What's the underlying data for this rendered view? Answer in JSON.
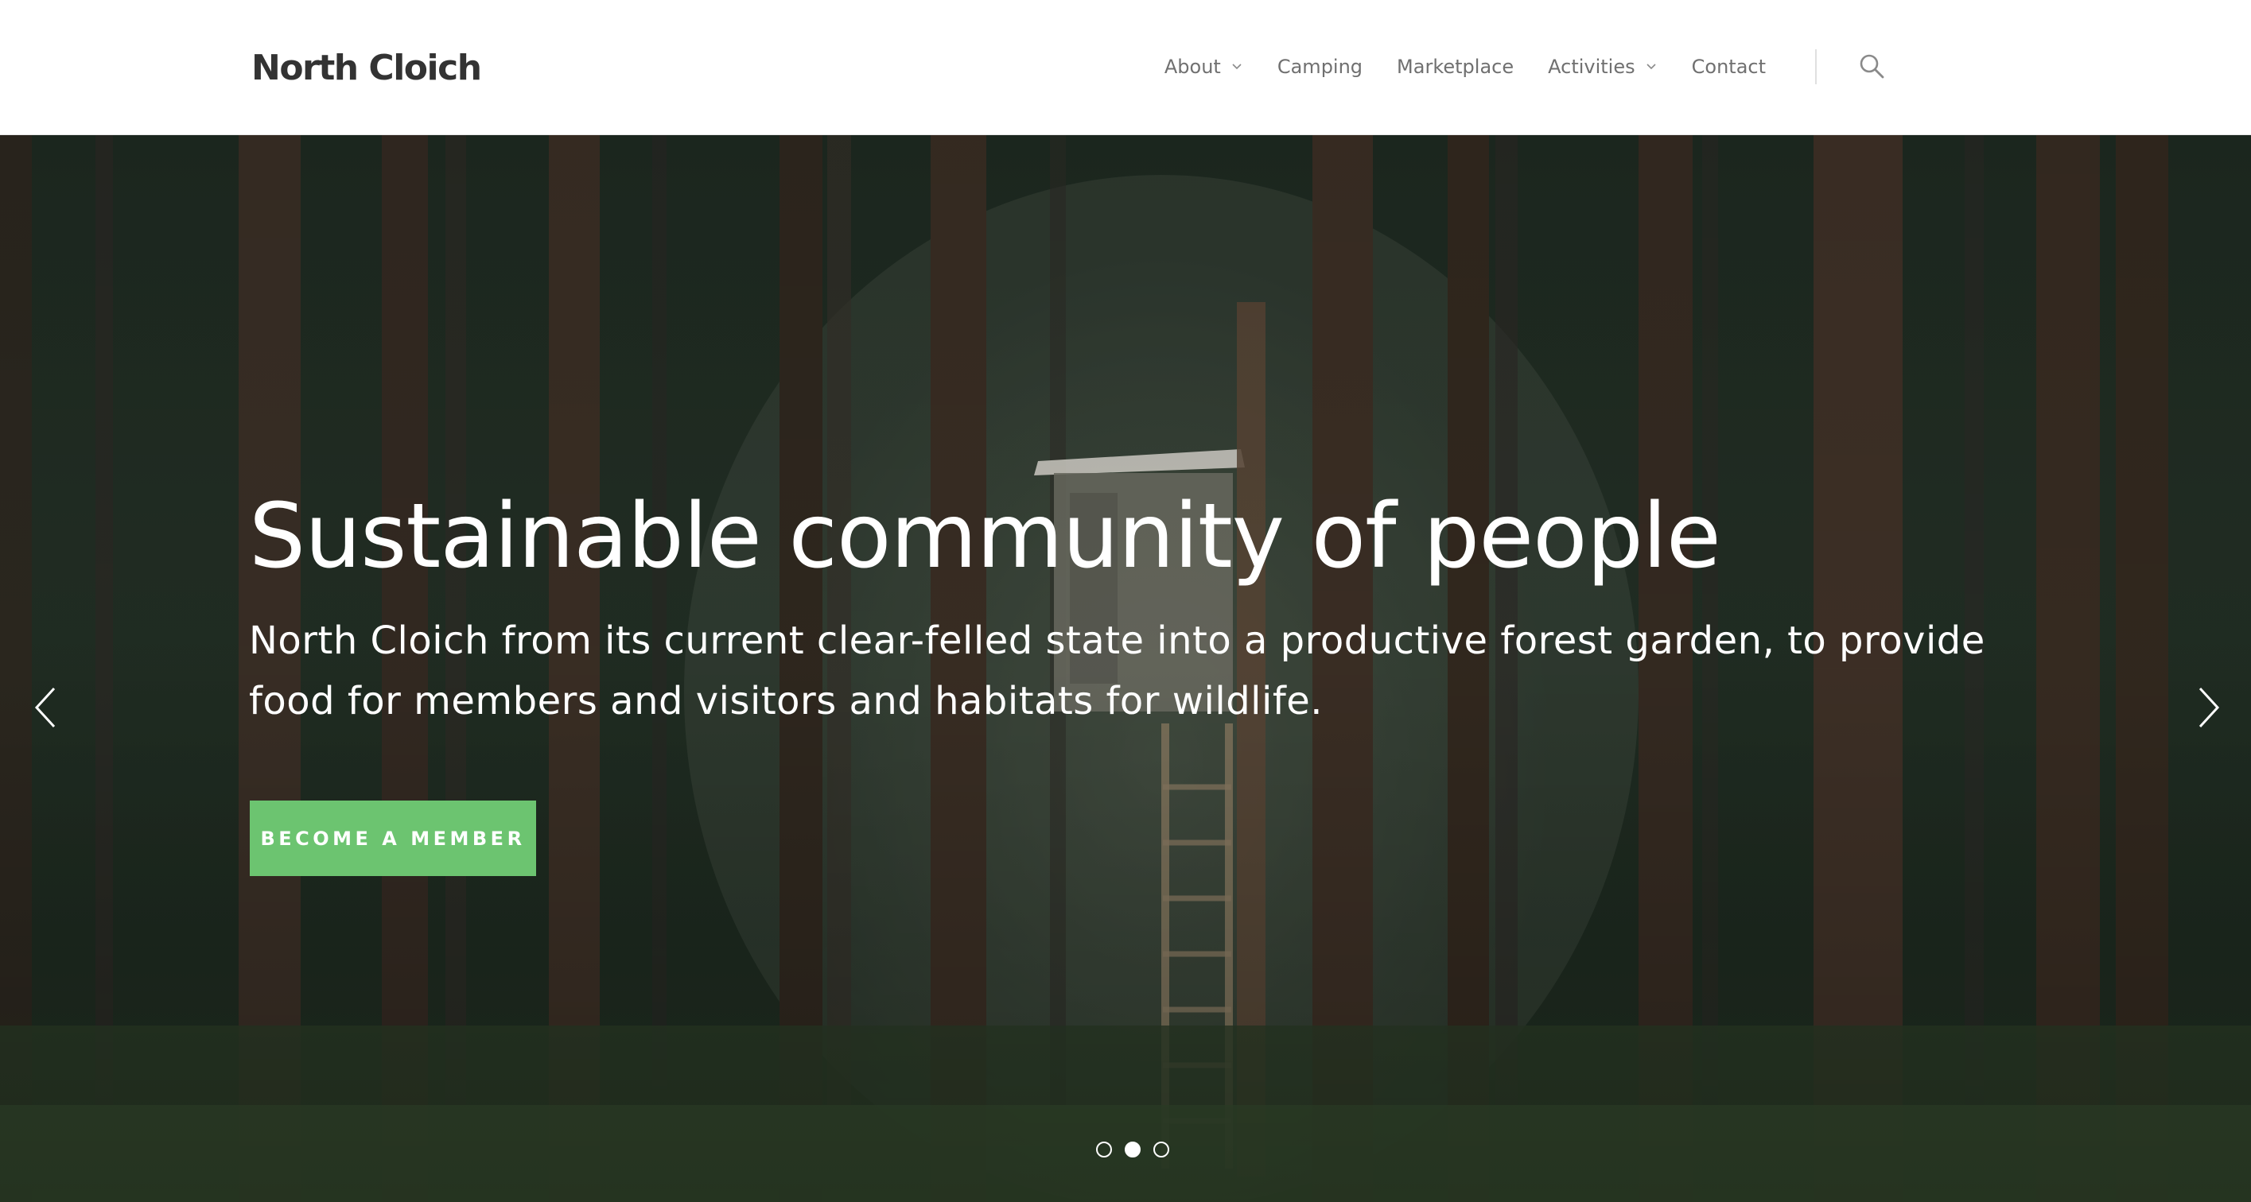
{
  "header": {
    "brand": "North Cloich",
    "nav": [
      {
        "label": "About",
        "has_dropdown": true
      },
      {
        "label": "Camping",
        "has_dropdown": false
      },
      {
        "label": "Marketplace",
        "has_dropdown": false
      },
      {
        "label": "Activities",
        "has_dropdown": true
      },
      {
        "label": "Contact",
        "has_dropdown": false
      }
    ],
    "search_icon": "search-icon"
  },
  "hero": {
    "title": "Sustainable community of people",
    "subtitle": "North Cloich from its current clear-felled state into a productive forest garden, to provide food for members and visitors and habitats for wildlife.",
    "cta_label": "BECOME A MEMBER",
    "prev_icon": "chevron-left-icon",
    "next_icon": "chevron-right-icon",
    "slides_total": 3,
    "active_slide": 2
  },
  "colors": {
    "accent": "#6cc470",
    "brand_text": "#333333",
    "nav_text": "#707070"
  }
}
